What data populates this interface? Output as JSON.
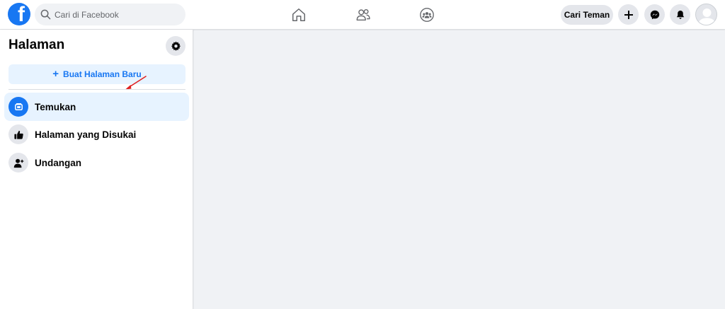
{
  "topbar": {
    "logo_letter": "f",
    "search_placeholder": "Cari di Facebook",
    "find_friends_label": "Cari Teman",
    "nav_icons": [
      "home-icon",
      "friends-icon",
      "groups-icon"
    ],
    "action_icons": [
      "plus-icon",
      "messenger-icon",
      "notifications-icon"
    ]
  },
  "sidebar": {
    "title": "Halaman",
    "create_page_label": "Buat Halaman Baru",
    "items": [
      {
        "label": "Temukan",
        "icon": "discover-icon",
        "active": true
      },
      {
        "label": "Halaman yang Disukai",
        "icon": "thumbs-up-icon",
        "active": false
      },
      {
        "label": "Undangan",
        "icon": "invite-user-icon",
        "active": false
      }
    ]
  },
  "colors": {
    "brand": "#1877f2",
    "background": "#f0f2f5",
    "button_gray": "#e4e6eb",
    "create_button_bg": "#e7f3ff",
    "annotation_arrow": "#e02020"
  }
}
